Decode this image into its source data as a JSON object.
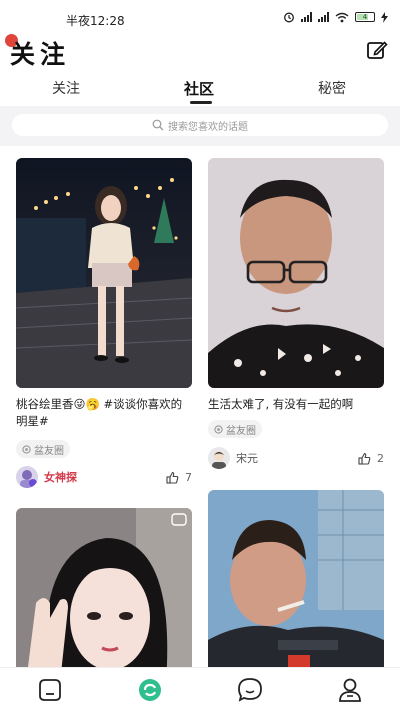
{
  "status": {
    "time": "半夜12:28",
    "battery": "4"
  },
  "header": {
    "title": "关注"
  },
  "tabs": [
    {
      "label": "关注"
    },
    {
      "label": "社区"
    },
    {
      "label": "秘密"
    }
  ],
  "search": {
    "placeholder": "搜索您喜欢的话题"
  },
  "posts": [
    {
      "title": "桃谷绘里香😜🥱 #谈谈你喜欢的明星#",
      "tag": "盆友圈",
      "author": "女神探",
      "likes": "7"
    },
    {
      "title": "生活太难了, 有没有一起的啊",
      "tag": "盆友圈",
      "author": "宋元",
      "likes": "2"
    },
    {
      "title": "",
      "tag": "",
      "author": "",
      "likes": ""
    },
    {
      "title": "",
      "tag": "",
      "author": "",
      "likes": ""
    }
  ],
  "bottom_nav": [
    {
      "icon": "home-icon"
    },
    {
      "icon": "community-icon"
    },
    {
      "icon": "message-icon"
    },
    {
      "icon": "profile-icon"
    }
  ],
  "colors": {
    "accent": "#2fbf8f",
    "author_highlight": "#d23a4a",
    "red_dot": "#e0453b"
  }
}
